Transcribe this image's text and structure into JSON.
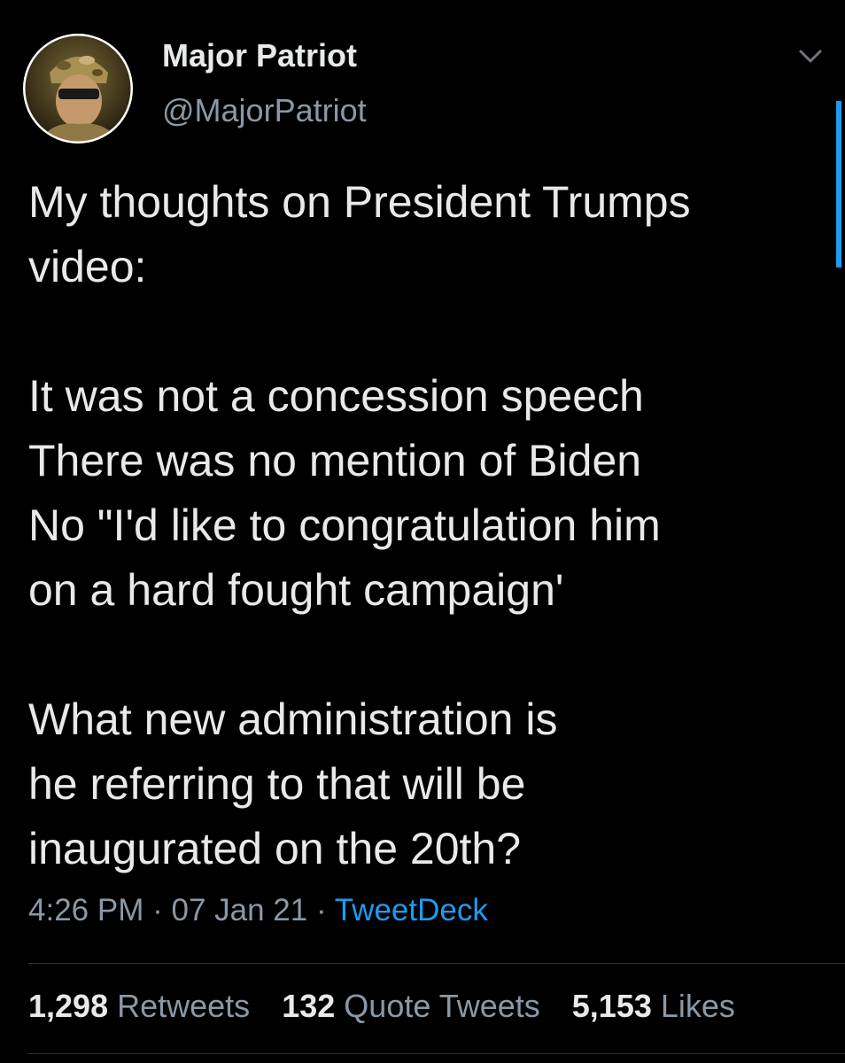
{
  "author": {
    "name": "Major Patriot",
    "handle": "@MajorPatriot",
    "avatar_icon": "profile-photo-icon"
  },
  "tweet": {
    "paragraphs": [
      [
        "My thoughts on President Trumps",
        "video:"
      ],
      [
        "It was not a concession speech",
        "There was no mention of Biden",
        "No \"I'd like to congratulation him",
        "on a hard fought campaign'"
      ],
      [
        "What new administration is",
        "he referring to that will be",
        "inaugurated on the 20th?"
      ]
    ],
    "time": "4:26 PM",
    "date": "07 Jan 21",
    "separator": "·",
    "source": "TweetDeck"
  },
  "stats": {
    "retweets_count": "1,298",
    "retweets_label": "Retweets",
    "quotes_count": "132",
    "quotes_label": "Quote Tweets",
    "likes_count": "5,153",
    "likes_label": "Likes"
  },
  "colors": {
    "background": "#000000",
    "text": "#e7e9ea",
    "secondary": "#8b98a5",
    "accent": "#1d9bf0",
    "divider": "#2f3336"
  },
  "icons": {
    "menu": "chevron-down-icon"
  }
}
